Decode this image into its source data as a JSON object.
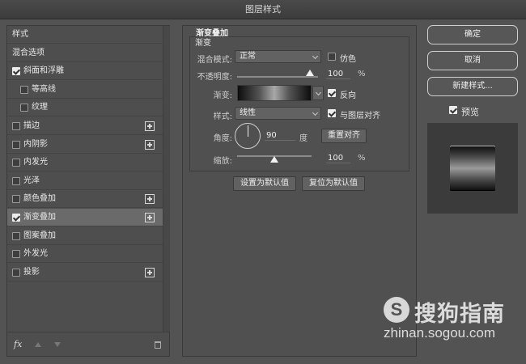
{
  "window": {
    "title": "图层样式"
  },
  "left_panel": {
    "items": [
      {
        "label": "样式",
        "checkbox": false,
        "checked": false,
        "indent": false,
        "plus": false,
        "selected": false
      },
      {
        "label": "混合选项",
        "checkbox": false,
        "checked": false,
        "indent": false,
        "plus": false,
        "selected": false
      },
      {
        "label": "斜面和浮雕",
        "checkbox": true,
        "checked": true,
        "indent": false,
        "plus": false,
        "selected": false
      },
      {
        "label": "等高线",
        "checkbox": true,
        "checked": false,
        "indent": true,
        "plus": false,
        "selected": false
      },
      {
        "label": "纹理",
        "checkbox": true,
        "checked": false,
        "indent": true,
        "plus": false,
        "selected": false
      },
      {
        "label": "描边",
        "checkbox": true,
        "checked": false,
        "indent": false,
        "plus": true,
        "selected": false
      },
      {
        "label": "内阴影",
        "checkbox": true,
        "checked": false,
        "indent": false,
        "plus": true,
        "selected": false
      },
      {
        "label": "内发光",
        "checkbox": true,
        "checked": false,
        "indent": false,
        "plus": false,
        "selected": false
      },
      {
        "label": "光泽",
        "checkbox": true,
        "checked": false,
        "indent": false,
        "plus": false,
        "selected": false
      },
      {
        "label": "颜色叠加",
        "checkbox": true,
        "checked": false,
        "indent": false,
        "plus": true,
        "selected": false
      },
      {
        "label": "渐变叠加",
        "checkbox": true,
        "checked": true,
        "indent": false,
        "plus": true,
        "selected": true
      },
      {
        "label": "图案叠加",
        "checkbox": true,
        "checked": false,
        "indent": false,
        "plus": false,
        "selected": false
      },
      {
        "label": "外发光",
        "checkbox": true,
        "checked": false,
        "indent": false,
        "plus": false,
        "selected": false
      },
      {
        "label": "投影",
        "checkbox": true,
        "checked": false,
        "indent": false,
        "plus": true,
        "selected": false
      }
    ],
    "footer": {
      "fx_label": "fx"
    }
  },
  "gradient_overlay": {
    "section_title": "渐变叠加",
    "group_title": "渐变",
    "blend_mode_label": "混合模式:",
    "blend_mode_value": "正常",
    "dither_label": "仿色",
    "dither_checked": false,
    "opacity_label": "不透明度:",
    "opacity_value": "100",
    "opacity_unit": "%",
    "opacity_fraction": 1.0,
    "gradient_label": "渐变:",
    "reverse_label": "反向",
    "reverse_checked": true,
    "style_label": "样式:",
    "style_value": "线性",
    "align_label": "与图层对齐",
    "align_checked": true,
    "angle_label": "角度:",
    "angle_value": "90",
    "angle_unit": "度",
    "reset_alignment_label": "重置对齐",
    "scale_label": "缩放:",
    "scale_value": "100",
    "scale_unit": "%",
    "scale_fraction": 0.5,
    "set_default_label": "设置为默认值",
    "reset_default_label": "复位为默认值"
  },
  "right_panel": {
    "ok_label": "确定",
    "cancel_label": "取消",
    "new_style_label": "新建样式...",
    "preview_label": "预览",
    "preview_checked": true
  },
  "watermark": {
    "title": "搜狗指南",
    "url": "zhinan.sogou.com"
  },
  "colors": {
    "background": "#535353",
    "panel": "#4e4e4e",
    "selected_row": "#6a6a6a",
    "text": "#e6e6e6"
  }
}
